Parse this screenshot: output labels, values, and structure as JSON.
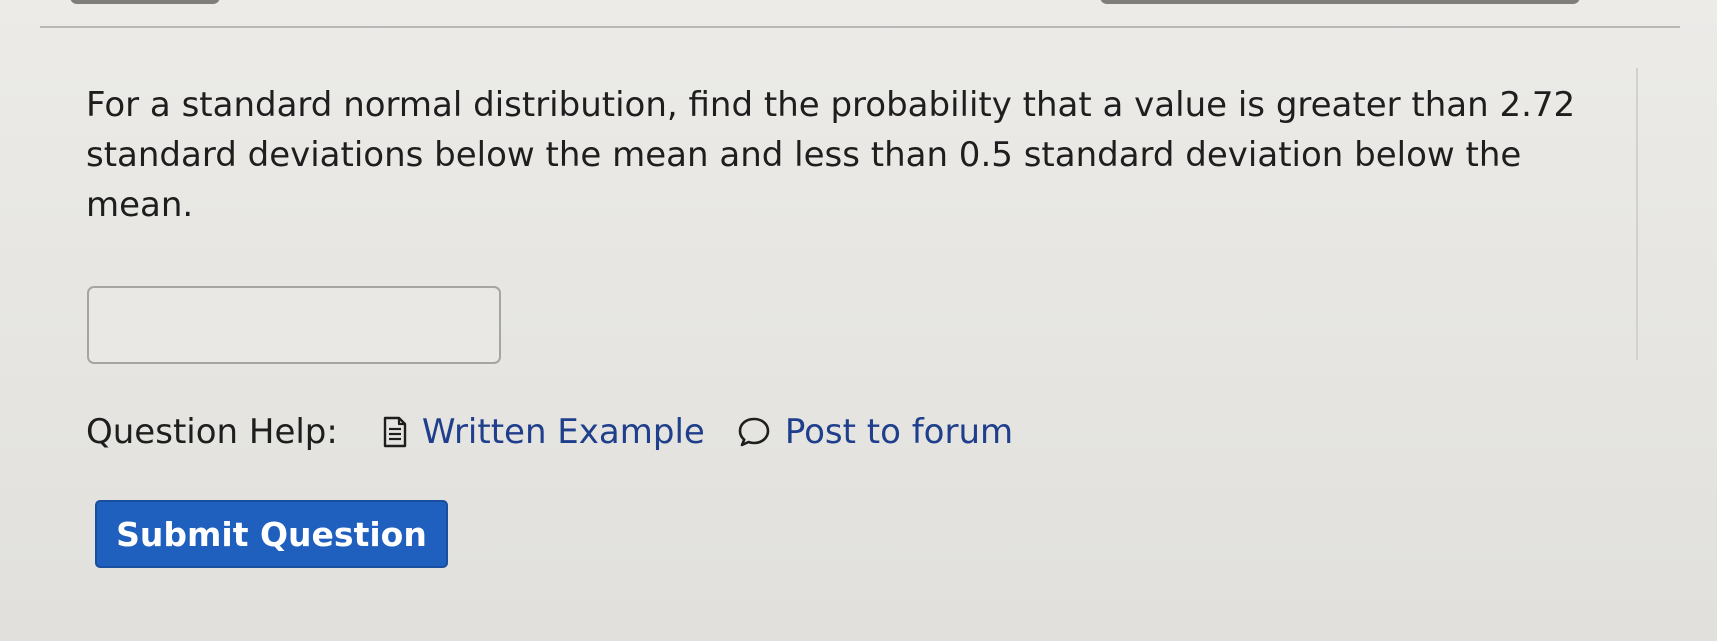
{
  "question": {
    "line1": "For a standard normal distribution, find the probability that a value is greater than 2.72",
    "line2": "standard deviations below the mean and less than 0.5 standard deviation below the",
    "line3": "mean."
  },
  "answer": {
    "value": "",
    "placeholder": ""
  },
  "help": {
    "label": "Question Help:",
    "written_example": {
      "label": "Written Example",
      "icon": "document-icon"
    },
    "post_to_forum": {
      "label": "Post to forum",
      "icon": "speech-bubble-icon"
    }
  },
  "submit": {
    "label": "Submit Question"
  },
  "colors": {
    "accent_button": "#1f5fbd",
    "link": "#1f3f8c",
    "background": "#e6e5e1"
  }
}
